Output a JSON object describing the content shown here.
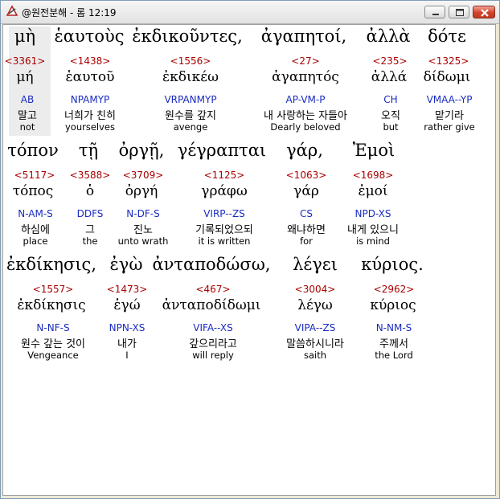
{
  "window": {
    "title": "@원전분해 - 롬 12:19"
  },
  "lines": [
    {
      "words": [
        {
          "surface": "μὴ",
          "strong": "<3361>",
          "lemma": "μή",
          "morph": "AB",
          "korean": "말고",
          "english": "not",
          "selected": true
        },
        {
          "surface": "ἑαυτοὺς",
          "strong": "<1438>",
          "lemma": "ἑαυτοῦ",
          "morph": "NPAMYP",
          "korean": "너희가 친히",
          "english": "yourselves"
        },
        {
          "surface": "ἐκδικοῦντες,",
          "strong": "<1556>",
          "lemma": "ἐκδικέω",
          "morph": "VRPANMYP",
          "korean": "원수를 갚지",
          "english": "avenge"
        },
        {
          "surface": "ἀγαπητοί,",
          "strong": "<27>",
          "lemma": "ἀγαπητός",
          "morph": "AP-VM-P",
          "korean": "내 사랑하는 자들아",
          "english": "Dearly beloved"
        },
        {
          "surface": "ἀλλὰ",
          "strong": "<235>",
          "lemma": "ἀλλά",
          "morph": "CH",
          "korean": "오직",
          "english": "but"
        },
        {
          "surface": "δότε",
          "strong": "<1325>",
          "lemma": "δίδωμι",
          "morph": "VMAA--YP",
          "korean": "맡기라",
          "english": "rather give"
        }
      ]
    },
    {
      "words": [
        {
          "surface": "τόπον",
          "strong": "<5117>",
          "lemma": "τόπος",
          "morph": "N-AM-S",
          "korean": "하심에",
          "english": "place"
        },
        {
          "surface": "τῇ",
          "strong": "<3588>",
          "lemma": "ὁ",
          "morph": "DDFS",
          "korean": "그",
          "english": "the"
        },
        {
          "surface": "ὀργῇ,",
          "strong": "<3709>",
          "lemma": "ὀργή",
          "morph": "N-DF-S",
          "korean": "진노",
          "english": "unto wrath"
        },
        {
          "surface": "γέγραπται",
          "strong": "<1125>",
          "lemma": "γράφω",
          "morph": "VIRP--ZS",
          "korean": "기록되었으되",
          "english": "it is written"
        },
        {
          "surface": "γάρ,",
          "strong": "<1063>",
          "lemma": "γάρ",
          "morph": "CS",
          "korean": "왜냐하면",
          "english": "for"
        },
        {
          "surface": "Ἐμοὶ",
          "strong": "<1698>",
          "lemma": "ἐμοί",
          "morph": "NPD-XS",
          "korean": "내게 있으니",
          "english": "is mind"
        }
      ]
    },
    {
      "words": [
        {
          "surface": "ἐκδίκησις,",
          "strong": "<1557>",
          "lemma": "ἐκδίκησις",
          "morph": "N-NF-S",
          "korean": "원수 갚는 것이",
          "english": "Vengeance"
        },
        {
          "surface": "ἐγὼ",
          "strong": "<1473>",
          "lemma": "ἐγώ",
          "morph": "NPN-XS",
          "korean": "내가",
          "english": "I"
        },
        {
          "surface": "ἀνταποδώσω,",
          "strong": "<467>",
          "lemma": "ἀνταποδίδωμι",
          "morph": "VIFA--XS",
          "korean": "갚으리라고",
          "english": "will reply"
        },
        {
          "surface": "λέγει",
          "strong": "<3004>",
          "lemma": "λέγω",
          "morph": "VIPA--ZS",
          "korean": "말씀하시니라",
          "english": "saith"
        },
        {
          "surface": "κύριος.",
          "strong": "<2962>",
          "lemma": "κύριος",
          "morph": "N-NM-S",
          "korean": "주께서",
          "english": "the Lord"
        }
      ]
    }
  ]
}
